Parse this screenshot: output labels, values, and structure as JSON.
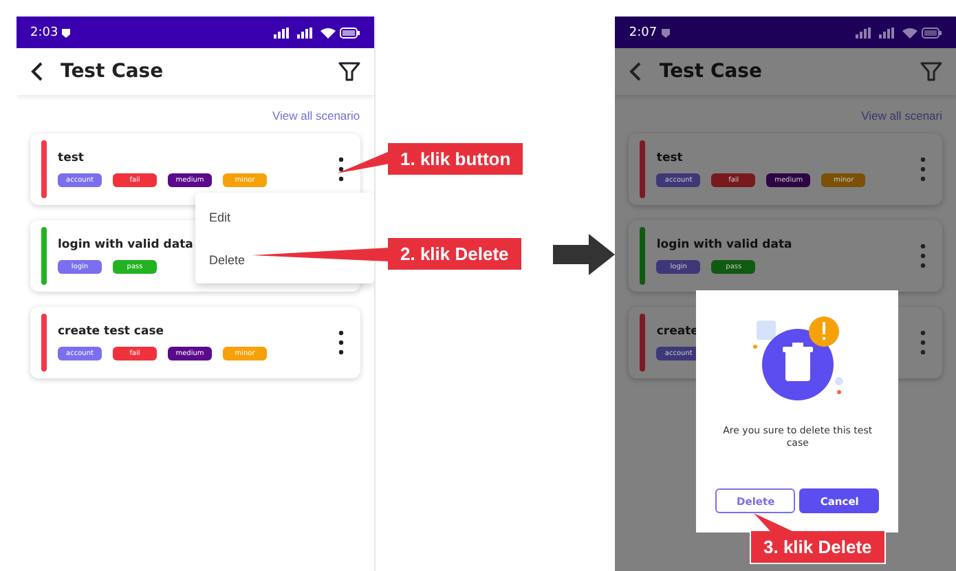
{
  "screens": [
    {
      "status_bar": {
        "time": "2:03"
      },
      "header": {
        "title": "Test Case"
      },
      "link": "View all scenario",
      "dimmed": false,
      "cards": [
        {
          "title": "test",
          "color": "#f03a47",
          "tags": [
            {
              "label": "account",
              "color": "#7b6ff0"
            },
            {
              "label": "fail",
              "color": "#f0323c"
            },
            {
              "label": "medium",
              "color": "#5a0a8a"
            },
            {
              "label": "minor",
              "color": "#f7a10a"
            }
          ]
        },
        {
          "title": "login with valid data",
          "color": "#22b322",
          "tags": [
            {
              "label": "login",
              "color": "#7b6ff0"
            },
            {
              "label": "pass",
              "color": "#22b322"
            }
          ]
        },
        {
          "title": "create test case",
          "color": "#f03a47",
          "tags": [
            {
              "label": "account",
              "color": "#7b6ff0"
            },
            {
              "label": "fail",
              "color": "#f0323c"
            },
            {
              "label": "medium",
              "color": "#5a0a8a"
            },
            {
              "label": "minor",
              "color": "#f7a10a"
            }
          ]
        }
      ],
      "menu": {
        "items": [
          "Edit",
          "Delete"
        ]
      }
    },
    {
      "status_bar": {
        "time": "2:07"
      },
      "header": {
        "title": "Test Case"
      },
      "link": "View all scenari",
      "dimmed": true,
      "cards": [
        {
          "title": "test",
          "color": "#781d24",
          "tags": [
            {
              "label": "account",
              "color": "#3e3878"
            },
            {
              "label": "fail",
              "color": "#78191e"
            },
            {
              "label": "medium",
              "color": "#2d0545"
            },
            {
              "label": "minor",
              "color": "#7c5005"
            }
          ]
        },
        {
          "title": "login with valid data",
          "color": "#115a11",
          "tags": [
            {
              "label": "login",
              "color": "#3e3878"
            },
            {
              "label": "pass",
              "color": "#115a11"
            }
          ]
        },
        {
          "title": "create",
          "color": "#781d24",
          "tags": [
            {
              "label": "account",
              "color": "#3e3878"
            }
          ]
        }
      ],
      "dialog": {
        "message": "Are you sure to delete this test case",
        "buttons": [
          {
            "label": "Delete",
            "kind": "outline"
          },
          {
            "label": "Cancel",
            "kind": "filled"
          }
        ]
      }
    }
  ],
  "callouts": [
    {
      "label": "1. klik button"
    },
    {
      "label": "2. klik Delete"
    },
    {
      "label": "3. klik Delete"
    }
  ]
}
